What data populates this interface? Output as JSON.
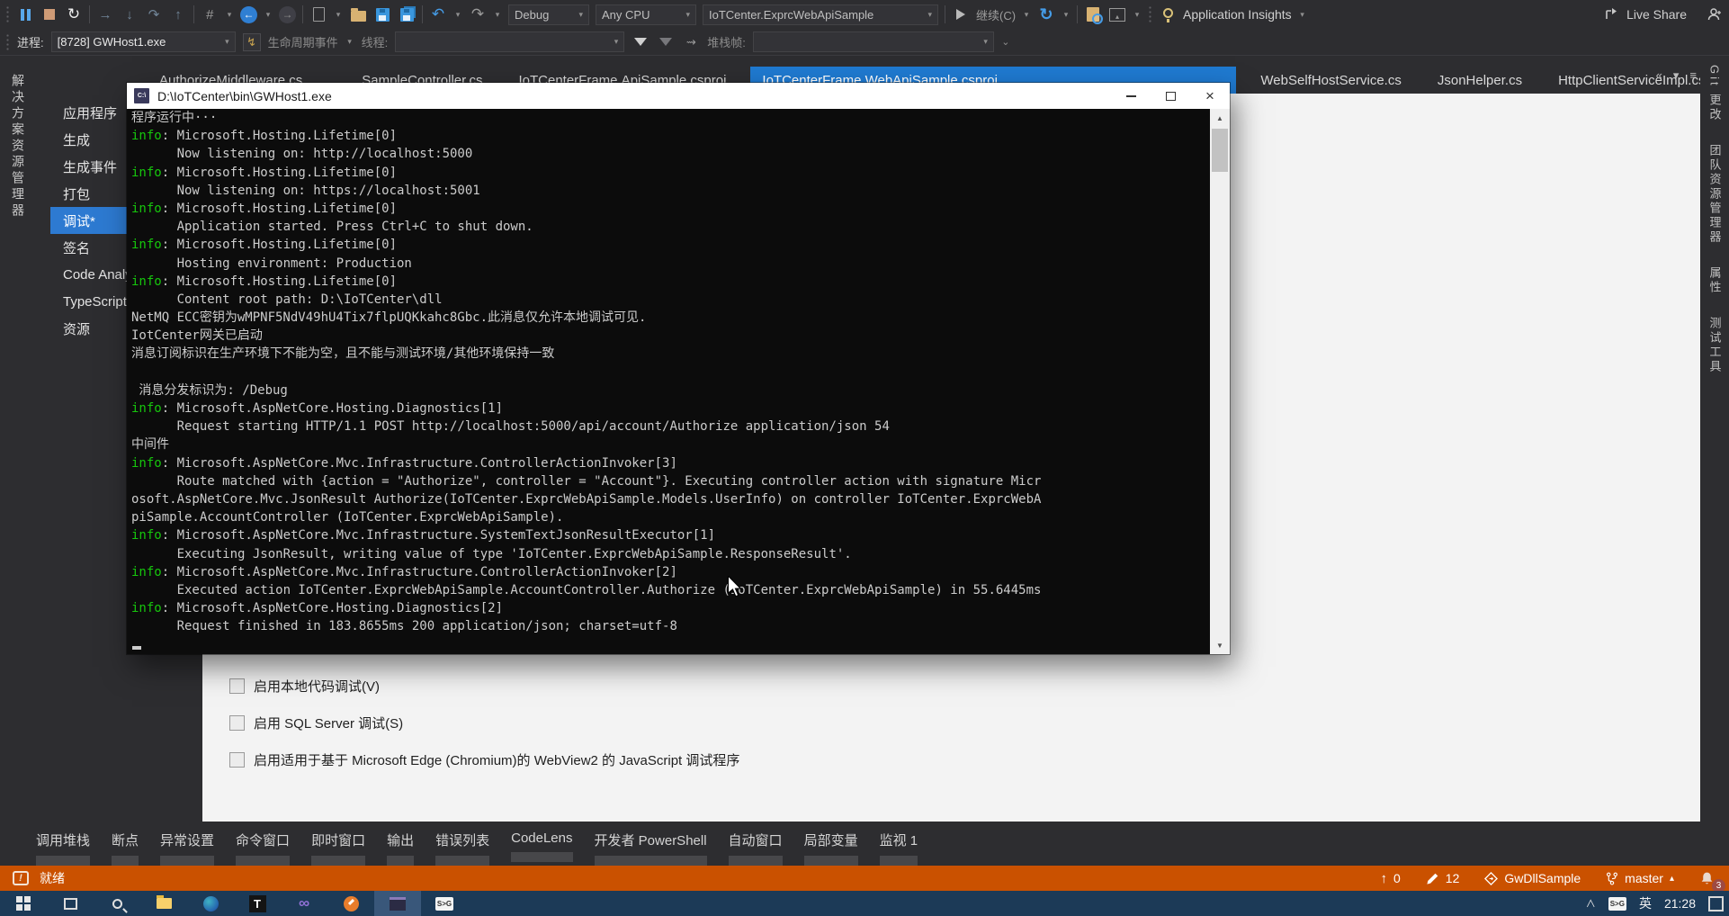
{
  "toolbar": {
    "debug_combo": "Debug",
    "cpu_combo": "Any CPU",
    "project_combo": "IoTCenter.ExprcWebApiSample",
    "continue_label": "继续(C)",
    "app_insights_label": "Application Insights",
    "live_share_label": "Live Share",
    "icons": [
      "pause-icon",
      "stop-icon",
      "restart-icon",
      "show-next-statement-icon",
      "step-into-icon",
      "step-over-icon",
      "step-out-icon",
      "hash-icon",
      "navigate-back-icon",
      "navigate-forward-icon",
      "new-file-icon",
      "open-folder-icon",
      "save-icon",
      "save-all-icon",
      "undo-icon",
      "redo-icon",
      "play-icon",
      "refresh-icon",
      "file-search-icon",
      "image-preview-icon",
      "lightbulb-icon",
      "share-icon",
      "person-icon"
    ]
  },
  "debugbar": {
    "process_label": "进程:",
    "process_value": "[8728] GWHost1.exe",
    "lifecycle_label": "生命周期事件",
    "thread_label": "线程:",
    "stack_label": "堆栈帧:"
  },
  "left_dock": {
    "solution_explorer": "解决方案资源管理器"
  },
  "tabs": [
    {
      "label": "AuthorizeMiddleware.cs",
      "state": "underline"
    },
    {
      "label": "SampleController.cs",
      "state": ""
    },
    {
      "label": "IoTCenterFrame.ApiSample.csproj",
      "state": ""
    },
    {
      "label": "IoTCenterFrame.WebApiSample.csproj",
      "state": "selected"
    },
    {
      "label": "WebSelfHostService.cs",
      "state": ""
    },
    {
      "label": "JsonHelper.cs",
      "state": ""
    },
    {
      "label": "HttpClientServiceImpl.cs",
      "state": ""
    }
  ],
  "well_icons": {
    "overflow": "«",
    "dropdown": "▾",
    "menu": "≡"
  },
  "prop_nav": {
    "items": [
      {
        "label": "应用程序",
        "state": ""
      },
      {
        "label": "生成",
        "state": ""
      },
      {
        "label": "生成事件",
        "state": ""
      },
      {
        "label": "打包",
        "state": ""
      },
      {
        "label": "调试*",
        "state": "selected"
      },
      {
        "label": "签名",
        "state": ""
      },
      {
        "label": "Code Analysis",
        "state": ""
      },
      {
        "label": "TypeScript",
        "state": ""
      },
      {
        "label": "资源",
        "state": ""
      }
    ]
  },
  "settings": {
    "checkboxes": [
      "启用本地代码调试(V)",
      "启用 SQL Server 调试(S)",
      "启用适用于基于 Microsoft Edge (Chromium)的 WebView2 的 JavaScript 调试程序"
    ]
  },
  "console": {
    "title": "D:\\IoTCenter\\bin\\GWHost1.exe",
    "icon_glyph": "C:\\",
    "lines": [
      "程序运行中···",
      "info: Microsoft.Hosting.Lifetime[0]",
      "      Now listening on: http://localhost:5000",
      "info: Microsoft.Hosting.Lifetime[0]",
      "      Now listening on: https://localhost:5001",
      "info: Microsoft.Hosting.Lifetime[0]",
      "      Application started. Press Ctrl+C to shut down.",
      "info: Microsoft.Hosting.Lifetime[0]",
      "      Hosting environment: Production",
      "info: Microsoft.Hosting.Lifetime[0]",
      "      Content root path: D:\\IoTCenter\\dll",
      "NetMQ ECC密钥为wMPNF5NdV49hU4Tix7flpUQKkahc8Gbc.此消息仅允许本地调试可见.",
      "IotCenter网关已启动",
      "消息订阅标识在生产环境下不能为空，且不能与测试环境/其他环境保持一致",
      "",
      " 消息分发标识为: /Debug",
      "info: Microsoft.AspNetCore.Hosting.Diagnostics[1]",
      "      Request starting HTTP/1.1 POST http://localhost:5000/api/account/Authorize application/json 54",
      "中间件",
      "info: Microsoft.AspNetCore.Mvc.Infrastructure.ControllerActionInvoker[3]",
      "      Route matched with {action = \"Authorize\", controller = \"Account\"}. Executing controller action with signature Micr",
      "osoft.AspNetCore.Mvc.JsonResult Authorize(IoTCenter.ExprcWebApiSample.Models.UserInfo) on controller IoTCenter.ExprcWebA",
      "piSample.AccountController (IoTCenter.ExprcWebApiSample).",
      "info: Microsoft.AspNetCore.Mvc.Infrastructure.SystemTextJsonResultExecutor[1]",
      "      Executing JsonResult, writing value of type 'IoTCenter.ExprcWebApiSample.ResponseResult'.",
      "info: Microsoft.AspNetCore.Mvc.Infrastructure.ControllerActionInvoker[2]",
      "      Executed action IoTCenter.ExprcWebApiSample.AccountController.Authorize (IoTCenter.ExprcWebApiSample) in 55.6445ms",
      "info: Microsoft.AspNetCore.Hosting.Diagnostics[2]",
      "      Request finished in 183.8655ms 200 application/json; charset=utf-8"
    ]
  },
  "bottom_tabs": [
    "调用堆栈",
    "断点",
    "异常设置",
    "命令窗口",
    "即时窗口",
    "输出",
    "错误列表",
    "CodeLens",
    "开发者 PowerShell",
    "自动窗口",
    "局部变量",
    "监视 1"
  ],
  "right_dock": {
    "tabs": [
      "Git 更改",
      "团队资源管理器",
      "属性",
      "测试工具"
    ]
  },
  "status_bar": {
    "ready_label": "就绪",
    "pushes": "0",
    "edits": "12",
    "repo": "GwDllSample",
    "branch": "master",
    "branch_caret": "▴",
    "notifications": "3"
  },
  "taskbar": {
    "t_app_glyph": "T",
    "vs_glyph": "∞",
    "sogou_glyph": "S>G",
    "chevron": "∧",
    "sogou_tray": "S>G",
    "ime_indicator": "英",
    "time": "21:28"
  },
  "colors": {
    "accent_blue": "#1f7ad1",
    "status_orange": "#ca5100",
    "console_green": "#16c60c",
    "taskbar_navy": "#1c3a57"
  }
}
